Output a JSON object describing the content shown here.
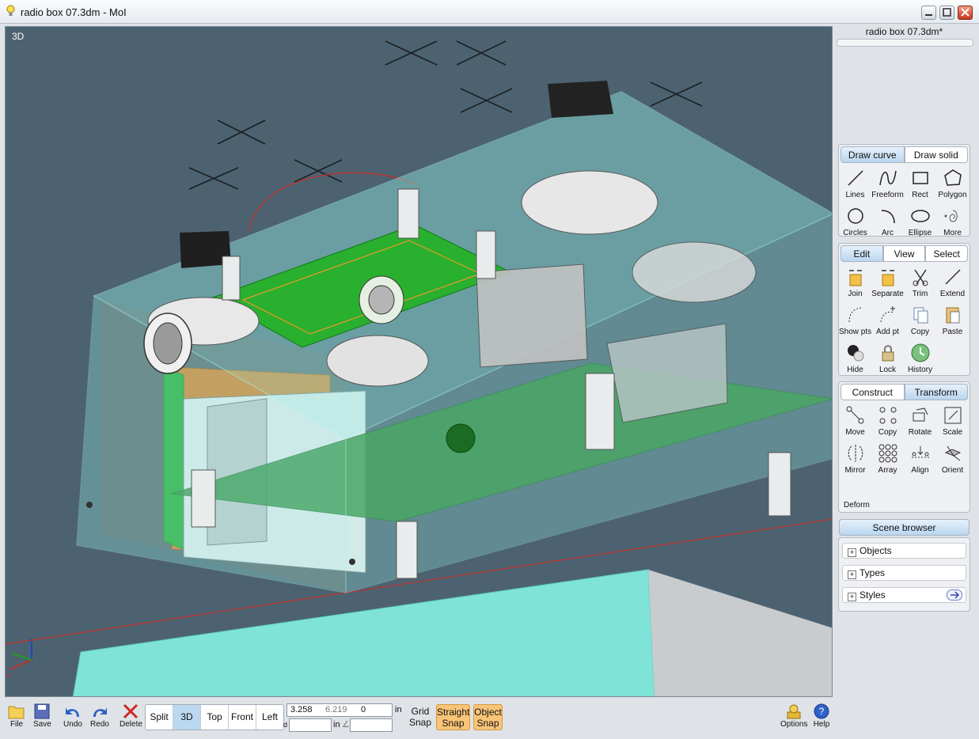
{
  "window": {
    "title": "radio box 07.3dm - MoI"
  },
  "viewport": {
    "label": "3D",
    "axis_z": "z",
    "axis_x": "x"
  },
  "side": {
    "doc_name": "radio box 07.3dm*",
    "draw": {
      "tabs": [
        "Draw curve",
        "Draw solid"
      ],
      "tools": [
        "Lines",
        "Freeform",
        "Rect",
        "Polygon",
        "Circles",
        "Arc",
        "Ellipse",
        "More"
      ]
    },
    "edit": {
      "tabs": [
        "Edit",
        "View",
        "Select"
      ],
      "tools": [
        "Join",
        "Separate",
        "Trim",
        "Extend",
        "Show pts",
        "Add pt",
        "Copy",
        "Paste",
        "Hide",
        "Lock",
        "History"
      ]
    },
    "construct": {
      "tabs": [
        "Construct",
        "Transform"
      ],
      "tools": [
        "Move",
        "Copy",
        "Rotate",
        "Scale",
        "Mirror",
        "Array",
        "Align",
        "Orient"
      ],
      "footer": "Deform"
    },
    "scene": {
      "title": "Scene browser",
      "items": [
        "Objects",
        "Types",
        "Styles"
      ]
    }
  },
  "bottom": {
    "file": "File",
    "save": "Save",
    "undo": "Undo",
    "redo": "Redo",
    "delete": "Delete",
    "views": [
      "Split",
      "3D",
      "Top",
      "Front",
      "Left"
    ],
    "coord_x": "3.258",
    "coord_y": "6.219",
    "coord_z": "0",
    "unit": "in",
    "d_label": "d",
    "angle_unit": "in",
    "grid_snap": [
      "Grid",
      "Snap"
    ],
    "straight_snap": [
      "Straight",
      "Snap"
    ],
    "object_snap": [
      "Object",
      "Snap"
    ],
    "options": "Options",
    "help": "Help"
  },
  "colors": {
    "viewport_bg": "#4d6271",
    "accent": "#bcd8f0",
    "snap_on": "#f8c478"
  }
}
